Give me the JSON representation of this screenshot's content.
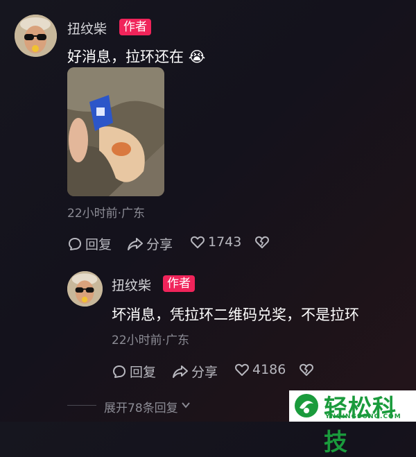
{
  "comment1": {
    "username": "扭纹柴",
    "badge": "作者",
    "text": "好消息，拉环还在",
    "emoji": "😭",
    "meta": "22小时前·广东",
    "reply_label": "回复",
    "share_label": "分享",
    "like_count": "1743"
  },
  "comment2": {
    "username": "扭纹柴",
    "badge": "作者",
    "text": "坏消息，凭拉环二维码兑奖，不是拉环",
    "meta": "22小时前·广东",
    "reply_label": "回复",
    "share_label": "分享",
    "like_count": "4186"
  },
  "expand": {
    "label": "展开78条回复"
  },
  "watermark": {
    "brand": "轻松科技",
    "site": "YNQINGSONG.COM"
  },
  "icons": {
    "comment_icon": "speech-bubble-icon",
    "share_icon": "share-arrow-icon",
    "like_icon": "heart-icon",
    "dislike_icon": "broken-heart-icon",
    "expand_icon": "chevron-down-icon"
  },
  "colors": {
    "badge": "#f0245a",
    "background": "#16161f",
    "meta_text": "#8c8c95",
    "watermark_green": "#1a9b3c"
  }
}
